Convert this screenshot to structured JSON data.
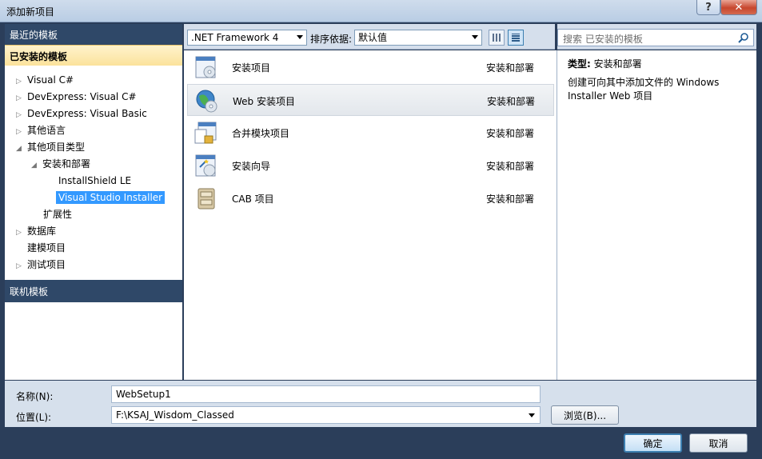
{
  "window": {
    "title": "添加新项目",
    "help_glyph": "?",
    "close_glyph": "✕"
  },
  "left_panel": {
    "recent_header": "最近的模板",
    "installed_header": "已安装的模板",
    "online_header": "联机模板",
    "tree": [
      {
        "label": "Visual C#",
        "expander": "▷",
        "level": 0
      },
      {
        "label": "DevExpress: Visual C#",
        "expander": "▷",
        "level": 0
      },
      {
        "label": "DevExpress: Visual Basic",
        "expander": "▷",
        "level": 0
      },
      {
        "label": "其他语言",
        "expander": "▷",
        "level": 0
      },
      {
        "label": "其他项目类型",
        "expander": "◢",
        "level": 0
      },
      {
        "label": "安装和部署",
        "expander": "◢",
        "level": 1
      },
      {
        "label": "InstallShield LE",
        "expander": "",
        "level": 2
      },
      {
        "label": "Visual Studio Installer",
        "expander": "",
        "level": 2,
        "selected": true
      },
      {
        "label": "扩展性",
        "expander": "",
        "level": 1
      },
      {
        "label": "数据库",
        "expander": "▷",
        "level": 0
      },
      {
        "label": "建模项目",
        "expander": "",
        "level": 0
      },
      {
        "label": "测试项目",
        "expander": "▷",
        "level": 0
      }
    ]
  },
  "toolbar": {
    "framework": ".NET Framework 4",
    "sort_label": "排序依据:",
    "sort_value": "默认值"
  },
  "templates": [
    {
      "name": "安装项目",
      "category": "安装和部署",
      "icon": "setup-project-icon"
    },
    {
      "name": "Web 安装项目",
      "category": "安装和部署",
      "icon": "web-setup-project-icon",
      "selected": true
    },
    {
      "name": "合并模块项目",
      "category": "安装和部署",
      "icon": "merge-module-icon"
    },
    {
      "name": "安装向导",
      "category": "安装和部署",
      "icon": "setup-wizard-icon"
    },
    {
      "name": "CAB 项目",
      "category": "安装和部署",
      "icon": "cab-project-icon"
    }
  ],
  "search": {
    "placeholder": "搜索 已安装的模板"
  },
  "info": {
    "type_label": "类型:",
    "type_value": "安装和部署",
    "description": "创建可向其中添加文件的 Windows Installer Web 项目"
  },
  "form": {
    "name_label": "名称(N):",
    "name_value": "WebSetup1",
    "location_label": "位置(L):",
    "location_value": "F:\\KSAJ_Wisdom_Classed",
    "browse_label": "浏览(B)..."
  },
  "buttons": {
    "ok": "确定",
    "cancel": "取消"
  },
  "colors": {
    "dialog_bg": "#2b3e5a",
    "selection": "#3399ff",
    "installed_header": "#fbe29b"
  }
}
